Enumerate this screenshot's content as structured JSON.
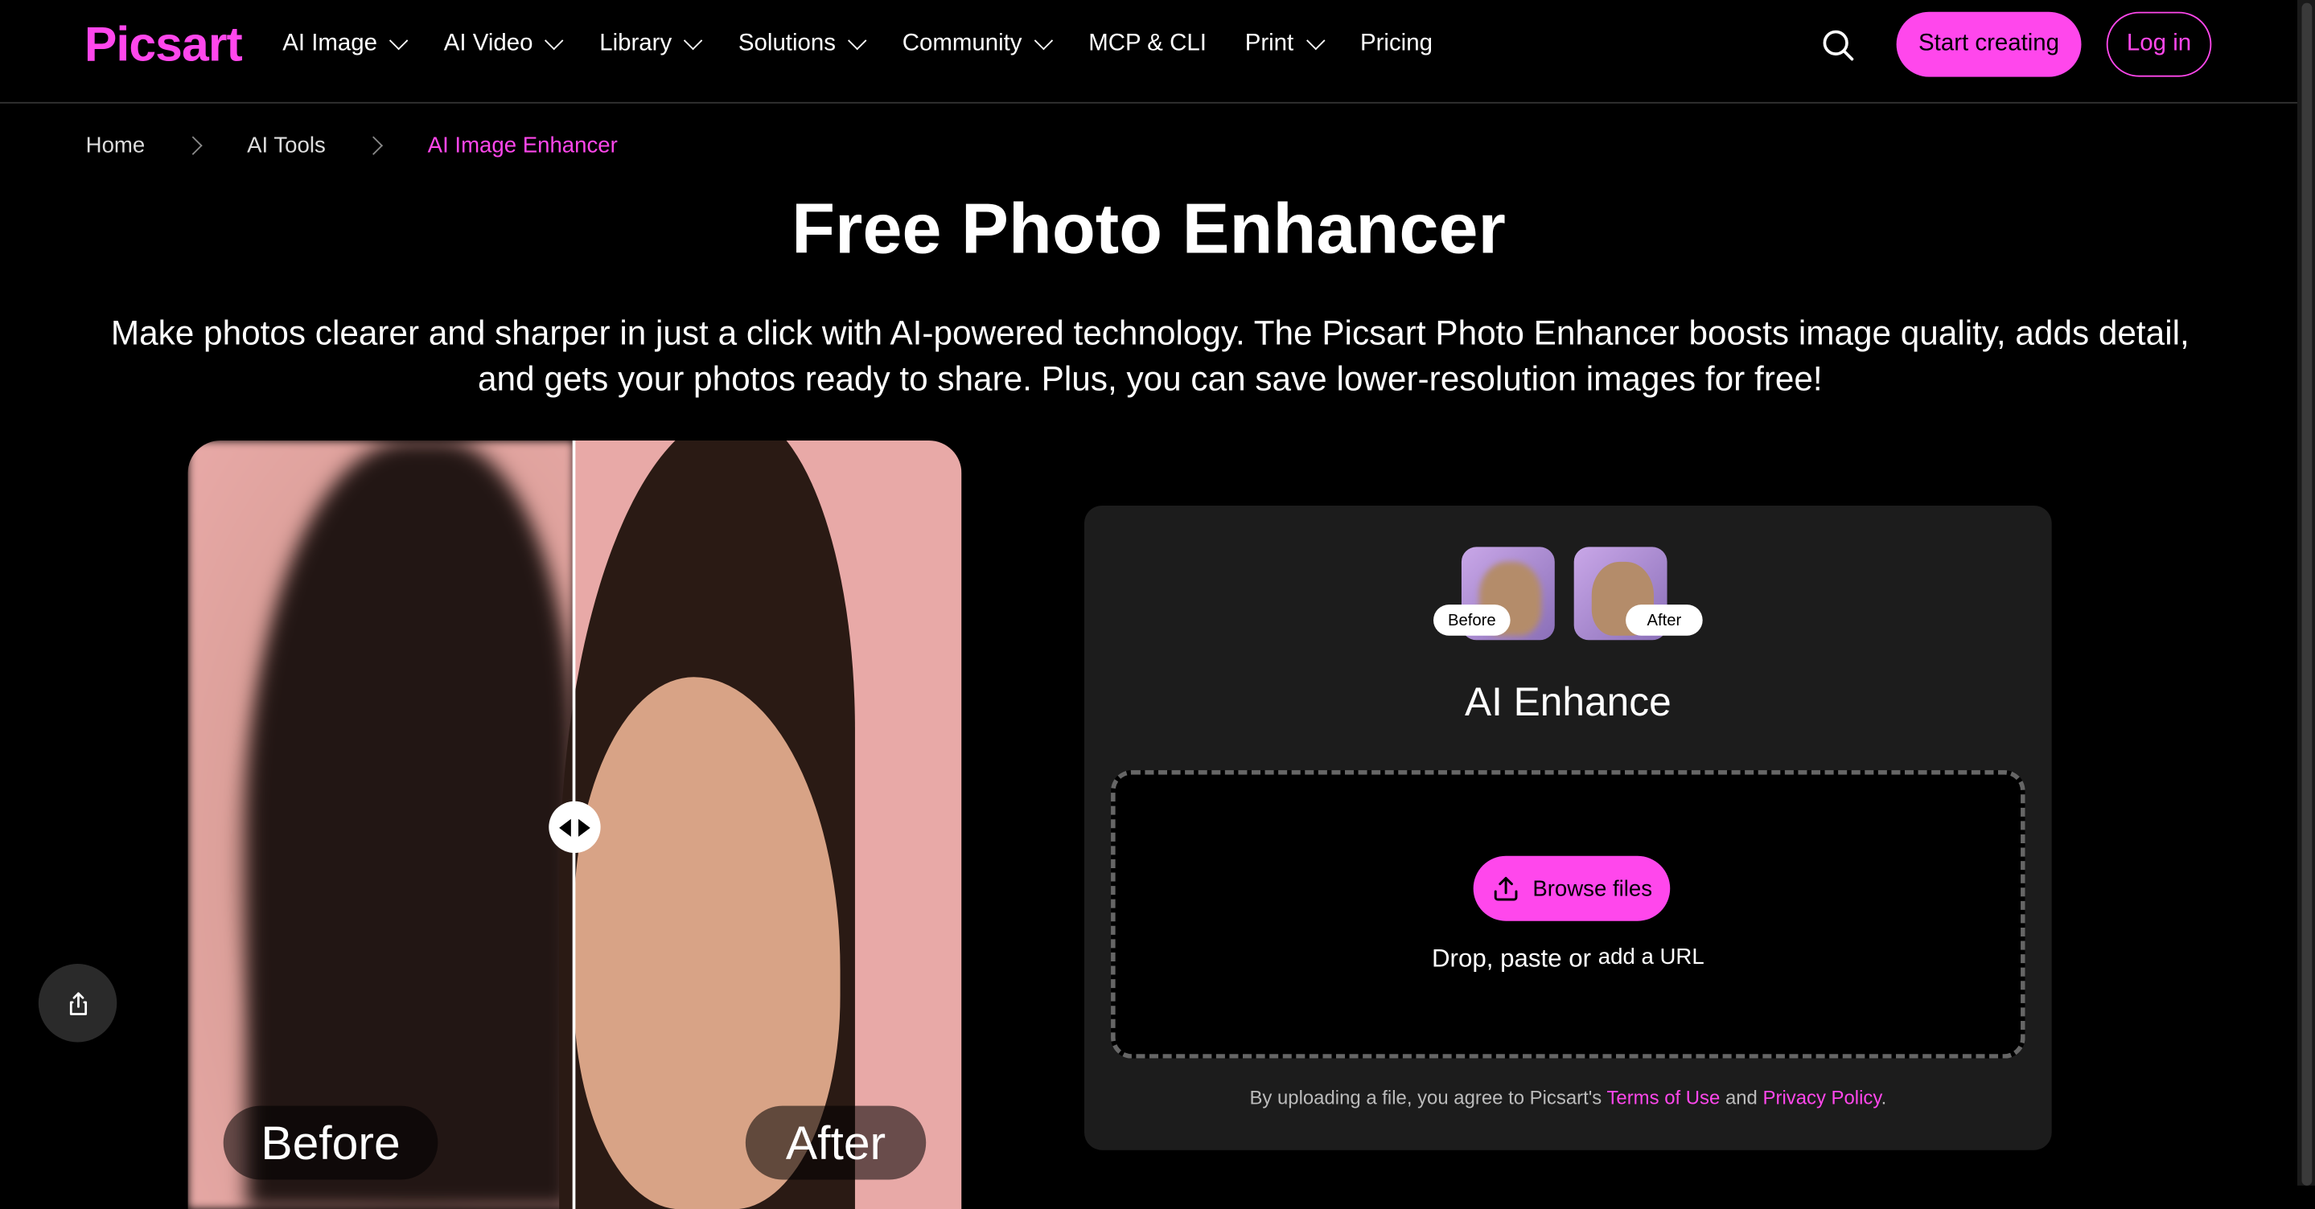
{
  "brand": {
    "logo_text": "Picsart",
    "accent": "#ff47ec"
  },
  "nav": {
    "items": [
      {
        "label": "AI Image",
        "has_dropdown": true
      },
      {
        "label": "AI Video",
        "has_dropdown": true
      },
      {
        "label": "Library",
        "has_dropdown": true
      },
      {
        "label": "Solutions",
        "has_dropdown": true
      },
      {
        "label": "Community",
        "has_dropdown": true
      },
      {
        "label": "MCP & CLI",
        "has_dropdown": false
      },
      {
        "label": "Print",
        "has_dropdown": true
      },
      {
        "label": "Pricing",
        "has_dropdown": false
      }
    ],
    "search_icon": "search-icon",
    "start_creating": "Start creating",
    "login": "Log in"
  },
  "breadcrumb": {
    "items": [
      "Home",
      "AI Tools",
      "AI Image Enhancer"
    ]
  },
  "hero": {
    "title": "Free Photo Enhancer",
    "subtitle": "Make photos clearer and sharper in just a click with AI-powered technology. The Picsart Photo Enhancer boosts image quality, adds detail, and gets your photos ready to share. Plus, you can save lower-resolution images for free!"
  },
  "comparison": {
    "before_label": "Before",
    "after_label": "After"
  },
  "upload": {
    "thumb_before": "Before",
    "thumb_after": "After",
    "title": "AI Enhance",
    "browse_label": "Browse files",
    "drop_text": "Drop, paste or",
    "url_link": "add a URL",
    "legal_prefix": "By uploading a file, you agree to Picsart's",
    "terms": "Terms of Use",
    "legal_and": "and",
    "privacy": "Privacy Policy",
    "legal_suffix": "."
  },
  "share_icon": "share-icon"
}
